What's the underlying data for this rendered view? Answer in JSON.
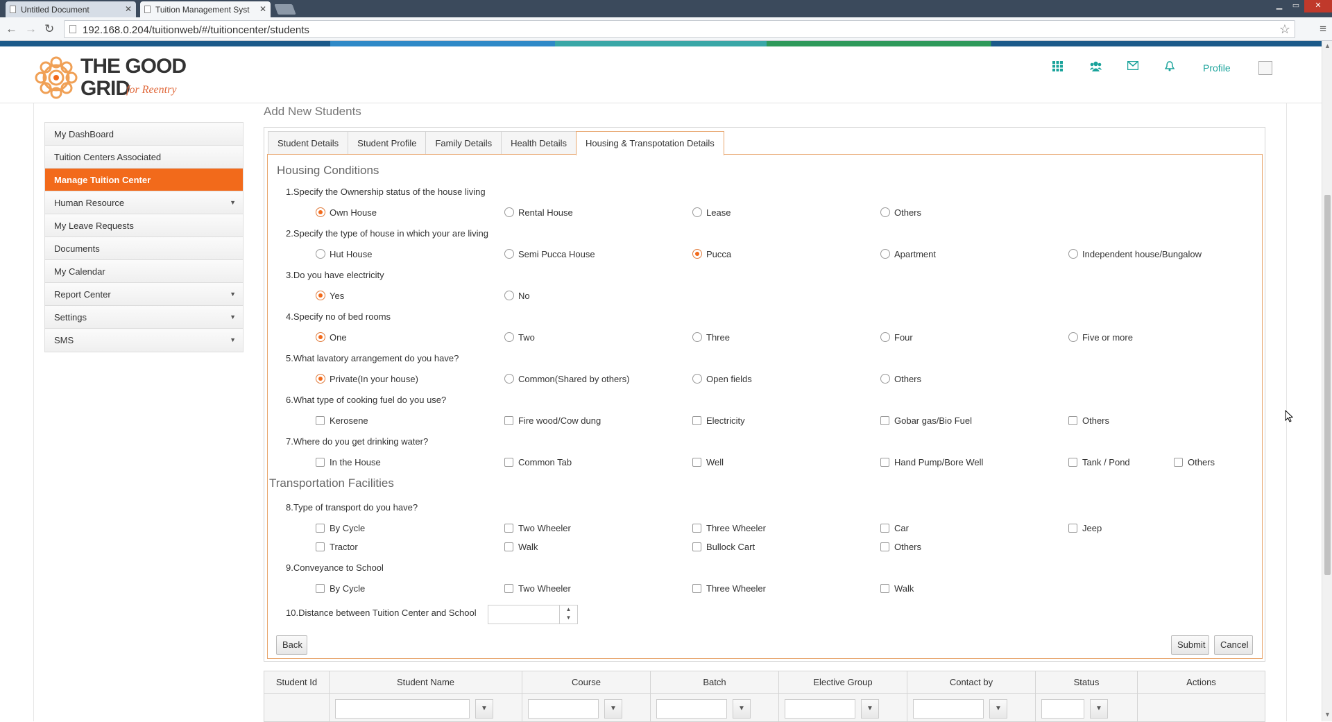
{
  "browser": {
    "tabs": [
      {
        "title": "Untitled Document"
      },
      {
        "title": "Tuition Management Syst"
      }
    ],
    "url": "192.168.0.204/tuitionweb/#/tuitioncenter/students"
  },
  "header": {
    "logo_line1": "THE GOOD",
    "logo_line2": "GRID",
    "logo_tag": "for Reentry",
    "profile_label": "Profile",
    "icons": [
      "grid-icon",
      "users-icon",
      "mail-icon",
      "bell-icon"
    ],
    "accent_color": "#1aa39b"
  },
  "sidebar": {
    "items": [
      {
        "label": "My DashBoard",
        "caret": false,
        "active": false
      },
      {
        "label": "Tuition Centers Associated",
        "caret": false,
        "active": false
      },
      {
        "label": "Manage Tuition Center",
        "caret": false,
        "active": true
      },
      {
        "label": "Human Resource",
        "caret": true,
        "active": false
      },
      {
        "label": "My Leave Requests",
        "caret": false,
        "active": false
      },
      {
        "label": "Documents",
        "caret": false,
        "active": false
      },
      {
        "label": "My Calendar",
        "caret": false,
        "active": false
      },
      {
        "label": "Report Center",
        "caret": true,
        "active": false
      },
      {
        "label": "Settings",
        "caret": true,
        "active": false
      },
      {
        "label": "SMS",
        "caret": true,
        "active": false
      }
    ],
    "active_color": "#f26a1b"
  },
  "main": {
    "page_title": "Add New Students",
    "tabs": [
      {
        "label": "Student Details"
      },
      {
        "label": "Student Profile"
      },
      {
        "label": "Family Details"
      },
      {
        "label": "Health Details"
      },
      {
        "label": "Housing & Transpotation Details"
      }
    ],
    "housing_title": "Housing Conditions",
    "transport_title": "Transportation Facilities",
    "questions": {
      "q1": {
        "text": "1.Specify the Ownership status of the house living",
        "options": [
          "Own House",
          "Rental House",
          "Lease",
          "Others"
        ],
        "selected": "Own House"
      },
      "q2": {
        "text": "2.Specify the type of house in which your are living",
        "options": [
          "Hut House",
          "Semi Pucca House",
          "Pucca",
          "Apartment",
          "Independent house/Bungalow"
        ],
        "selected": "Pucca"
      },
      "q3": {
        "text": "3.Do you have electricity",
        "options": [
          "Yes",
          "No"
        ],
        "selected": "Yes"
      },
      "q4": {
        "text": "4.Specify no of bed rooms",
        "options": [
          "One",
          "Two",
          "Three",
          "Four",
          "Five or more"
        ],
        "selected": "One"
      },
      "q5": {
        "text": "5.What lavatory arrangement do you have?",
        "options": [
          "Private(In your house)",
          "Common(Shared by others)",
          "Open fields",
          "Others"
        ],
        "selected": "Private(In your house)"
      },
      "q6": {
        "text": "6.What type of cooking fuel do you use?",
        "options": [
          "Kerosene",
          "Fire wood/Cow dung",
          "Electricity",
          "Gobar gas/Bio Fuel",
          "Others"
        ]
      },
      "q7": {
        "text": "7.Where do you get drinking water?",
        "options": [
          "In the House",
          "Common Tab",
          "Well",
          "Hand Pump/Bore Well",
          "Tank / Pond",
          "Others"
        ]
      },
      "q8": {
        "text": "8.Type of transport do you have?",
        "options": [
          "By Cycle",
          "Two Wheeler",
          "Three Wheeler",
          "Car",
          "Jeep",
          "Tractor",
          "Walk",
          "Bullock Cart",
          "Others"
        ]
      },
      "q9": {
        "text": "9.Conveyance to School",
        "options": [
          "By Cycle",
          "Two Wheeler",
          "Three Wheeler",
          "Walk"
        ]
      },
      "q10": {
        "text": "10.Distance between Tuition Center and School",
        "value": ""
      }
    },
    "buttons": {
      "back": "Back",
      "submit": "Submit",
      "cancel": "Cancel"
    }
  },
  "grid": {
    "columns": [
      "Student Id",
      "Student Name",
      "Course",
      "Batch",
      "Elective Group",
      "Contact by",
      "Status",
      "Actions"
    ]
  }
}
